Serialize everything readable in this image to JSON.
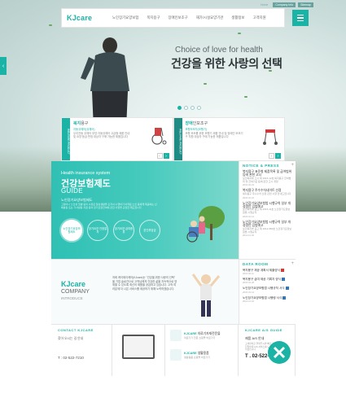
{
  "colors": {
    "accent": "#1ab3a6",
    "accent_dark": "#1e8c84",
    "doc_red": "#d33333",
    "doc_blue": "#3377bb"
  },
  "header": {
    "logo": "KJcare",
    "nav": [
      "노인장기요양보험",
      "복지용구",
      "장애인보조구",
      "재가/시설요양기관",
      "생활정보",
      "고객지원"
    ],
    "top_links": [
      "Home",
      "Company Info",
      "Sitemap"
    ],
    "menu_icon": "hamburger-icon"
  },
  "hero": {
    "subtitle": "Choice of love for health",
    "title": "건강을 위한 사랑의 선택",
    "slides": 4,
    "active_slide": 0,
    "left_arrow": "‹"
  },
  "cards": [
    {
      "tab": "WELFARE PRODUCT",
      "title_a": "복지",
      "title_b": "용구",
      "product": "자동휠체어(휠체어)",
      "desc": "우리전동 휠체어 부양 자동휠체어 고급형 제품 안내 및 요양 등급 판정 대상자 구매 가능한 제품입니다",
      "image": "wheelchair",
      "prev": "‹",
      "next": "›"
    },
    {
      "tab": "WELFARE PRODUCT",
      "title_a": "장애",
      "title_b": "인보조구",
      "product": "보행보조차(보행기)",
      "desc": "보행 보조를 위한 보행기 제품 안내 및 장애인 보조기구 지원 대상자 구매 가능한 제품입니다",
      "image": "walker",
      "prev": "‹",
      "next": "›"
    }
  ],
  "insurance": {
    "en": "Health insurance system",
    "ko": "건강보험제도",
    "guide": "GUIDE",
    "sub": "노인장기요양보험제도",
    "desc": "고령이나 노인성 질병 등의 사유로 일상생활을 혼자서 수행하기 어려운 노인 등에게 제공하는 신체활동 또는 가사활동 지원 등의 장기요양급여에 관한 사항을 규정한 제도입니다",
    "steps": [
      "노인장기요양보험제도",
      "장기요양 인정절차",
      "장기요양 급여종류",
      "본인부담금"
    ],
    "active": 0
  },
  "notice": {
    "heading": "NOTICE & PRESS",
    "more": "+",
    "items": [
      {
        "title": "복지용구 표준형 제품목록 및 급여범위 등에 관한 고시",
        "desc": "보건복지부 고시 제 2015-12호 복지용구 급여범위 및 급여기준 등에 관한 고시 개정",
        "date": "2015.02.24"
      },
      {
        "title": "복지용구 주수수차네이트 선정",
        "desc": "복지용구 주수수차 선정 관련 사항 안내드립니다",
        "date": "2015.01.16"
      },
      {
        "title": "노인장기요양보험법 시행규칙 일부 개정령안 입법예고",
        "desc": "보건복지부 공고 제 2015-11호 노인장기요양보험법 시행규칙",
        "date": "2015.01.14"
      },
      {
        "title": "노인장기요양보험법 시행규칙 일부 개정령안 입법예고",
        "desc": "보건복지부 공고 제 2014-982호 노인장기요양보험법 시행규칙",
        "date": "2014.12.30"
      }
    ]
  },
  "company": {
    "logo": "KJcare",
    "title": "COMPANY",
    "sub": "INTRODUCE",
    "text": "저희 케이제이케어(KJcare)는 \"건강을 위한 사랑의 선택\" 을 기업 슬로건으로 고객님에게 건강한 삶을 지속적으로 영위할 수 있도록 최선의 제품을 공급하고 있습니다. 고객 여러분께 더 나은 서비스를 제공하기 위해 노력하겠습니다."
  },
  "data_room": {
    "heading": "DATA ROOM",
    "more": "+",
    "items": [
      {
        "title": "복지용구 제공 계획서 제출양식",
        "type": "pdf",
        "date": "2015.02.11"
      },
      {
        "title": "복지용구 급여 제공 기록지 양식",
        "type": "doc",
        "date": "2015.01.28"
      },
      {
        "title": "노인장기요양보험법 시행규칙 서식",
        "type": "doc",
        "date": "2015.01.14"
      },
      {
        "title": "노인장기요양보험법 시행령 서식",
        "type": "doc",
        "date": "2014.12.22"
      }
    ]
  },
  "contact": {
    "heading": "CONTACT KJCARE",
    "sub": "찾아 오시는 길 안내",
    "phone": "T : 02-522-7210"
  },
  "quick": [
    {
      "brand": "KJCARE",
      "title": "의료기자재전문몰",
      "sub": "의료기기 전문 쇼핑몰 바로가기"
    },
    {
      "brand": "KJCARE",
      "title": "생활용품",
      "sub": "생활용품 쇼핑몰 바로가기"
    }
  ],
  "as": {
    "heading": "KJCARE A/S GUIDE",
    "sub": "제품 A/S 안내",
    "desc": "고객센터로 연락주시면 빠르고 친절하게 A/S 서비스를 도와드리겠습니다",
    "phone": "T . 02-522-7210"
  }
}
